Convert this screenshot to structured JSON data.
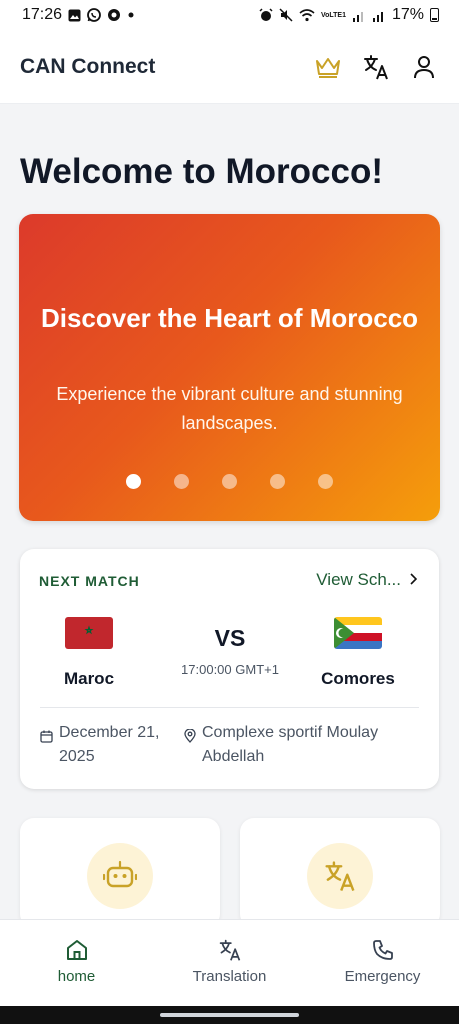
{
  "status_bar": {
    "time": "17:26",
    "notif_icons": [
      "image-icon",
      "whatsapp-icon",
      "chrome-icon",
      "dot-icon"
    ],
    "system_icons": [
      "alarm-icon",
      "mute-icon",
      "wifi-icon",
      "volte-icon",
      "signal-icon",
      "signal-icon",
      "battery-icon"
    ],
    "network_label": "VoLTE1",
    "battery": "17%"
  },
  "header": {
    "title": "CAN Connect",
    "icons": [
      "crown-icon",
      "translate-icon",
      "user-icon"
    ],
    "crown_color": "#c9a227"
  },
  "welcome": {
    "title": "Welcome to Morocco!"
  },
  "hero": {
    "title": "Discover the Heart of Morocco",
    "subtitle": "Experience the vibrant culture and stunning landscapes.",
    "slide_count": 5,
    "active_slide": 1,
    "gradient": [
      "#dc3a2b",
      "#e8591c",
      "#f59e0b"
    ]
  },
  "next_match": {
    "label": "NEXT MATCH",
    "view_link": "View Sch...",
    "home_team": "Maroc",
    "away_team": "Comores",
    "vs": "VS",
    "kickoff": "17:00:00 GMT+1",
    "date": "December 21, 2025",
    "venue": "Complexe sportif Moulay Abdellah",
    "accent": "#1f5c35"
  },
  "feature_tiles": [
    {
      "icon": "robot-icon"
    },
    {
      "icon": "translate-icon"
    }
  ],
  "bottom_nav": {
    "items": [
      {
        "label": "home",
        "icon": "home-icon",
        "active": true
      },
      {
        "label": "Translation",
        "icon": "translate-icon",
        "active": false
      },
      {
        "label": "Emergency",
        "icon": "phone-icon",
        "active": false
      }
    ]
  }
}
